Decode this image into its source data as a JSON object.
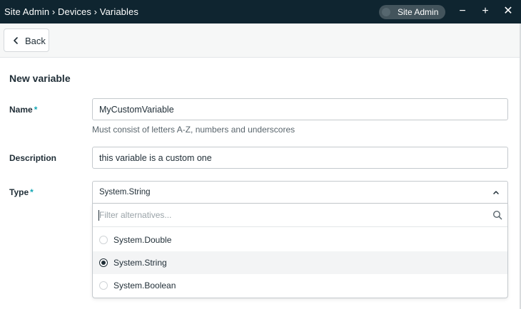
{
  "window": {
    "breadcrumb": "Site Admin › Devices › Variables",
    "user_label": "Site Admin",
    "minimize_glyph": "−",
    "maximize_glyph": "+",
    "close_glyph": "✕"
  },
  "toolbar": {
    "back_label": "Back"
  },
  "form": {
    "title": "New variable",
    "name": {
      "label": "Name",
      "required_mark": "*",
      "value": "MyCustomVariable",
      "hint": "Must consist of letters A-Z, numbers and underscores"
    },
    "description": {
      "label": "Description",
      "value": "this variable is a custom one"
    },
    "type": {
      "label": "Type",
      "required_mark": "*",
      "value": "System.String",
      "filter_placeholder": "Filter alternatives...",
      "options": [
        {
          "label": "System.Double",
          "selected": false
        },
        {
          "label": "System.String",
          "selected": true
        },
        {
          "label": "System.Boolean",
          "selected": false
        }
      ]
    }
  },
  "colors": {
    "titlebar": "#0f2530",
    "accent_required": "#13a6b4",
    "toolbar_bg": "#f6f7f7"
  },
  "icons": [
    "chevron-left-icon",
    "chevron-up-icon",
    "search-icon",
    "radio-icon"
  ]
}
